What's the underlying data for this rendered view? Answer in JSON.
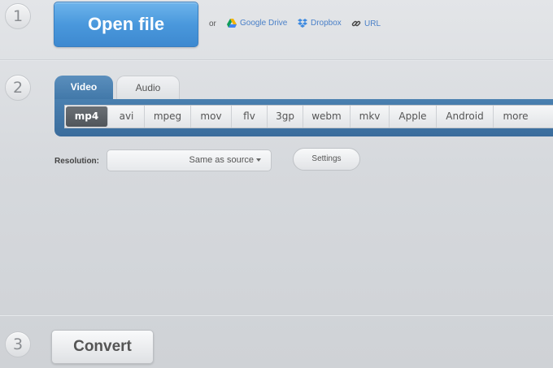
{
  "step1": {
    "number": "1",
    "open_button": "Open file",
    "or_text": "or",
    "sources": [
      {
        "label": "Google Drive",
        "icon": "google-drive-icon"
      },
      {
        "label": "Dropbox",
        "icon": "dropbox-icon"
      },
      {
        "label": "URL",
        "icon": "link-icon"
      }
    ]
  },
  "step2": {
    "number": "2",
    "tabs": [
      {
        "label": "Video",
        "active": true
      },
      {
        "label": "Audio",
        "active": false
      }
    ],
    "formats": [
      "mp4",
      "avi",
      "mpeg",
      "mov",
      "flv",
      "3gp",
      "webm",
      "mkv",
      "Apple",
      "Android",
      "more"
    ],
    "selected_format": "mp4",
    "resolution_label": "Resolution:",
    "resolution_value": "Same as source",
    "settings_button": "Settings"
  },
  "step3": {
    "number": "3",
    "convert_button": "Convert"
  },
  "colors": {
    "primary_blue": "#4a98dc",
    "tab_panel_blue": "#3f76a7",
    "link_blue": "#4a80c8"
  }
}
